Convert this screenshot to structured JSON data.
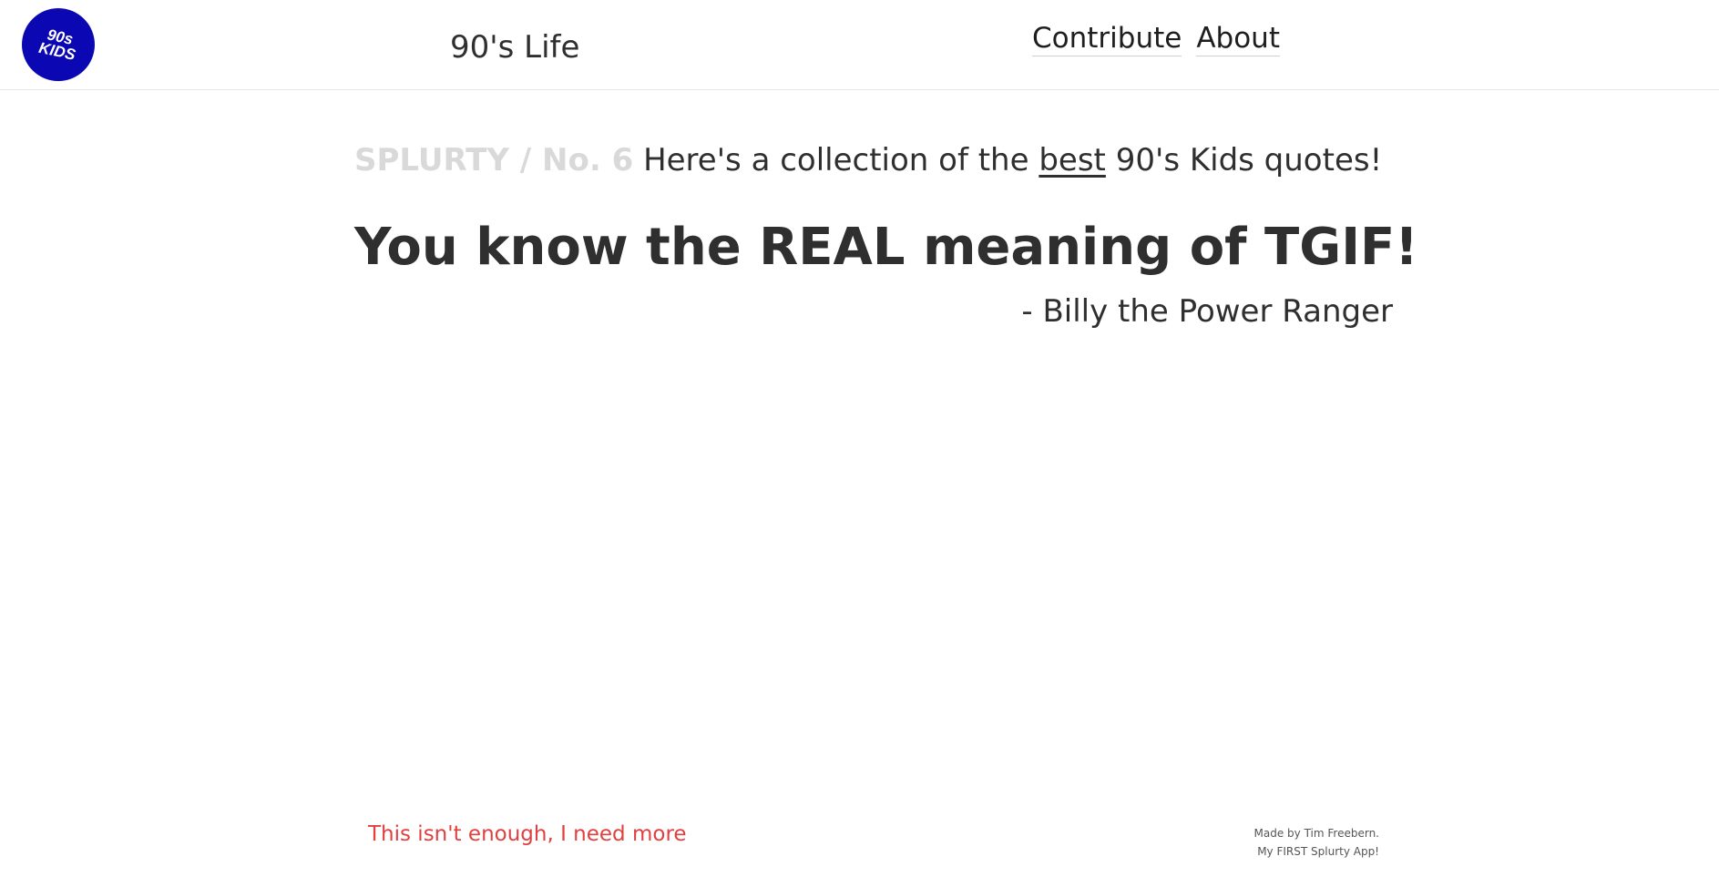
{
  "header": {
    "logo_text": "90s\nKIDS",
    "site_title": "90's Life",
    "nav": [
      {
        "label": "Contribute"
      },
      {
        "label": "About"
      }
    ]
  },
  "intro": {
    "splurty_label": "SPLURTY / No. 6",
    "text_before": "Here's a collection of the",
    "emphasis": "best",
    "text_after": "90's Kids quotes!"
  },
  "quote": {
    "text": "You know the REAL meaning of TGIF!",
    "author": "- Billy the Power Ranger"
  },
  "footer": {
    "more_link": "This isn't enough, I need more",
    "credit_line1": "Made by Tim Freebern.",
    "credit_line2": "My FIRST Splurty App!"
  },
  "colors": {
    "logo_bg": "#0a07b3",
    "splurty_label": "#d9d9d9",
    "more_link": "#e0403f"
  }
}
